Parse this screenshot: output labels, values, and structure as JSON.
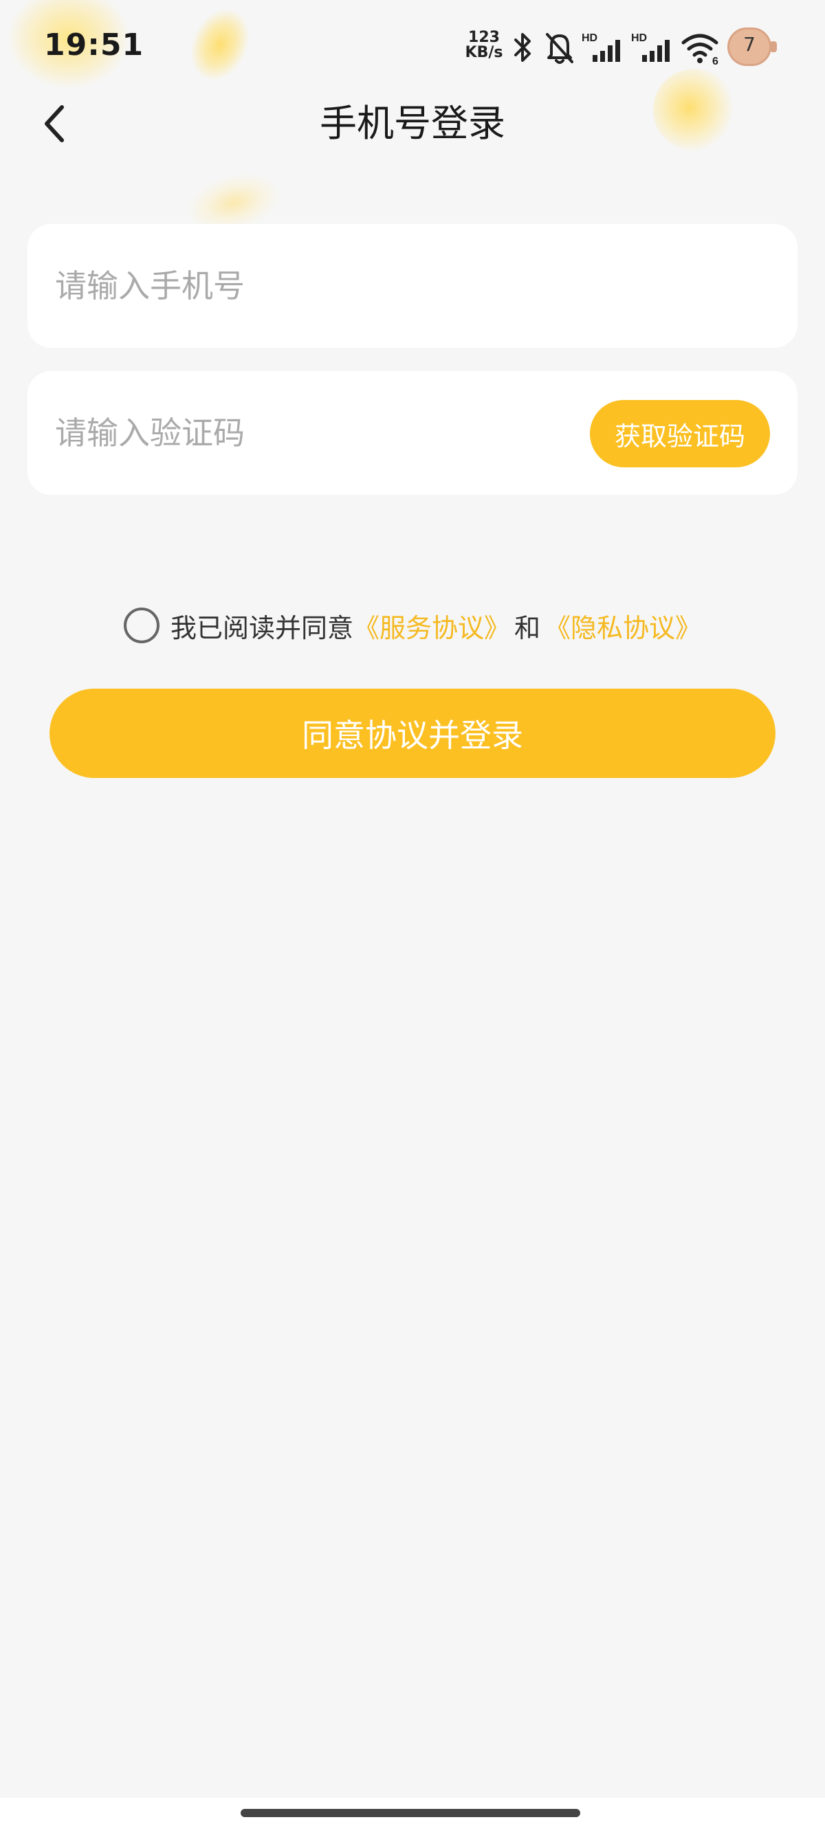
{
  "status_bar": {
    "time": "19:51",
    "net_speed_value": "123",
    "net_speed_unit": "KB/s",
    "signal_label_1": "HD",
    "signal_label_2": "HD",
    "wifi_label": "6",
    "battery": "7",
    "icons": [
      "bluetooth-icon",
      "bell-muted-icon",
      "signal-icon",
      "signal-icon",
      "wifi-icon",
      "battery-icon"
    ]
  },
  "header": {
    "back_icon": "chevron-left-icon",
    "title": "手机号登录"
  },
  "form": {
    "phone_placeholder": "请输入手机号",
    "phone_value": "",
    "code_placeholder": "请输入验证码",
    "code_value": "",
    "get_code_label": "获取验证码"
  },
  "agreement": {
    "checked": false,
    "prefix": "我已阅读并同意",
    "service_link": "《服务协议》",
    "and_text": "和",
    "privacy_link": "《隐私协议》"
  },
  "login_button_label": "同意协议并登录",
  "colors": {
    "accent": "#fcc023",
    "link": "#f5b921",
    "background": "#f6f6f6",
    "card": "#ffffff"
  }
}
